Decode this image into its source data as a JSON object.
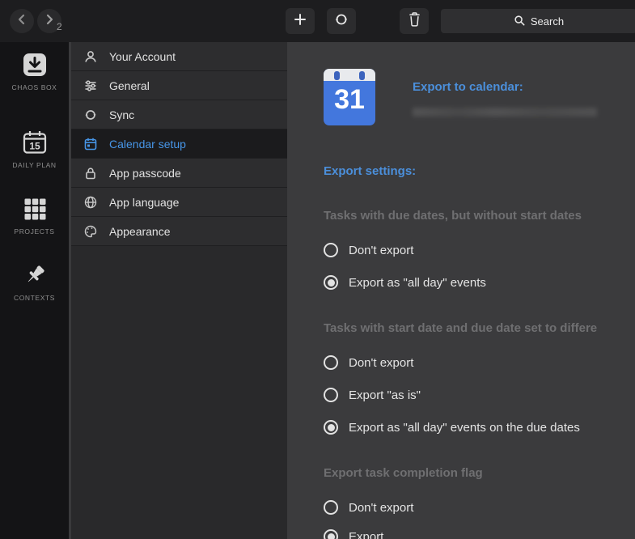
{
  "toolbar": {
    "search_placeholder": "Search"
  },
  "nav": {
    "badge": "2",
    "items": [
      {
        "label": "CHAOS BOX",
        "icon": "chaos-box-icon"
      },
      {
        "label": "DAILY PLAN",
        "icon": "daily-plan-icon",
        "day": "15"
      },
      {
        "label": "PROJECTS",
        "icon": "projects-icon"
      },
      {
        "label": "CONTEXTS",
        "icon": "contexts-icon"
      }
    ]
  },
  "settings_menu": {
    "items": [
      {
        "label": "Your Account",
        "icon": "user-icon",
        "selected": false
      },
      {
        "label": "General",
        "icon": "tune-icon",
        "selected": false
      },
      {
        "label": "Sync",
        "icon": "sync-icon",
        "selected": false
      },
      {
        "label": "Calendar setup",
        "icon": "calendar-icon",
        "selected": true
      },
      {
        "label": "App passcode",
        "icon": "lock-icon",
        "selected": false
      },
      {
        "label": "App language",
        "icon": "globe-icon",
        "selected": false
      },
      {
        "label": "Appearance",
        "icon": "palette-icon",
        "selected": false
      }
    ]
  },
  "content": {
    "calendar_day": "31",
    "export_heading": "Export to calendar:",
    "settings_heading": "Export settings:",
    "account_line_redacted": true,
    "sections": [
      {
        "title": "Tasks with due dates, but without start dates",
        "options": [
          {
            "label": "Don't export",
            "selected": false
          },
          {
            "label": "Export as \"all day\" events",
            "selected": true
          }
        ]
      },
      {
        "title": "Tasks with start date and due date set to differe",
        "options": [
          {
            "label": "Don't export",
            "selected": false
          },
          {
            "label": "Export \"as is\"",
            "selected": false
          },
          {
            "label": "Export as \"all day\" events on the due dates",
            "selected": true
          }
        ]
      },
      {
        "title": "Export task completion flag",
        "options": [
          {
            "label": "Don't export",
            "selected": false
          },
          {
            "label": "Export",
            "selected": true
          }
        ]
      }
    ]
  }
}
